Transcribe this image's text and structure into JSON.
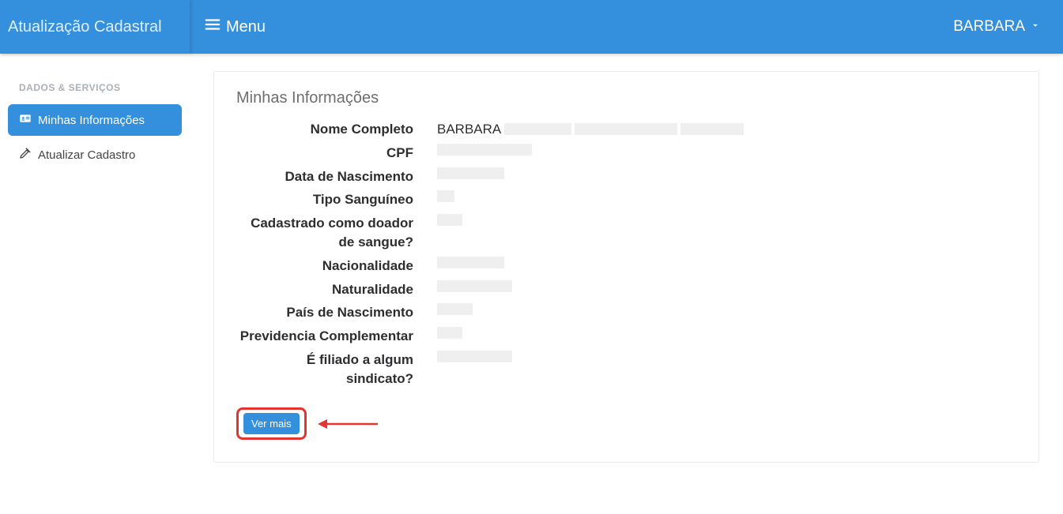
{
  "header": {
    "brand": "Atualização Cadastral",
    "menu_label": "Menu",
    "user_name": "BARBARA"
  },
  "sidebar": {
    "section_heading": "DADOS & SERVIÇOS",
    "items": [
      {
        "label": "Minhas Informações",
        "active": true
      },
      {
        "label": "Atualizar Cadastro",
        "active": false
      }
    ]
  },
  "card": {
    "title": "Minhas Informações",
    "ver_mais_label": "Ver mais",
    "rows": [
      {
        "label": "Nome Completo",
        "value": "BARBARA"
      },
      {
        "label": "CPF",
        "value": ""
      },
      {
        "label": "Data de Nascimento",
        "value": ""
      },
      {
        "label": "Tipo Sanguíneo",
        "value": ""
      },
      {
        "label": "Cadastrado como doador de sangue?",
        "value": ""
      },
      {
        "label": "Nacionalidade",
        "value": ""
      },
      {
        "label": "Naturalidade",
        "value": ""
      },
      {
        "label": "País de Nascimento",
        "value": ""
      },
      {
        "label": "Previdencia Complementar",
        "value": ""
      },
      {
        "label": "É filiado a algum sindicato?",
        "value": ""
      }
    ]
  },
  "annotation": {
    "highlight_color": "#e3342f"
  }
}
